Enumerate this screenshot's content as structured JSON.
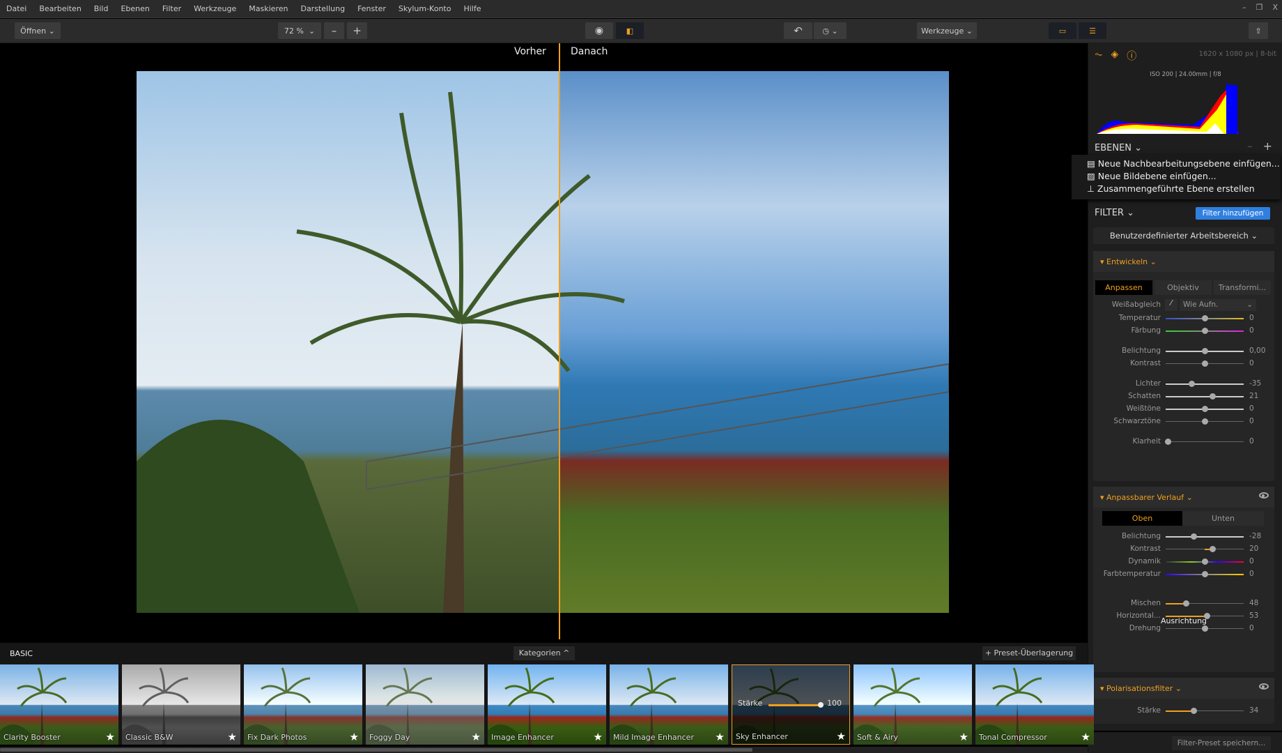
{
  "menu": [
    "Datei",
    "Bearbeiten",
    "Bild",
    "Ebenen",
    "Filter",
    "Werkzeuge",
    "Maskieren",
    "Darstellung",
    "Fenster",
    "Skylum-Konto",
    "Hilfe"
  ],
  "window_controls": {
    "minimize": "–",
    "restore": "❐",
    "close": "X"
  },
  "toolbar": {
    "open": "Öffnen",
    "zoom": "72 %",
    "zoom_out": "–",
    "zoom_in": "+",
    "tools": "Werkzeuge"
  },
  "canvas": {
    "before": "Vorher",
    "after": "Danach"
  },
  "info": {
    "dimensions": "1620 x 1080 px | 8-bit",
    "exif": "ISO 200 | 24.00mm | f/8"
  },
  "layers": {
    "title": "EBENEN",
    "menu": [
      "Neue Nachbearbeitungsebene einfügen...",
      "Neue Bildebene einfügen...",
      "Zusammengeführte Ebene erstellen"
    ]
  },
  "filter": {
    "title": "FILTER",
    "add": "Filter hinzufügen",
    "workspace": "Benutzerdefinierter Arbeitsbereich"
  },
  "develop": {
    "title": "Entwickeln",
    "tabs": [
      "Anpassen",
      "Objektiv",
      "Transformi..."
    ],
    "wb_label": "Weißabgleich",
    "wb_value": "Wie Aufn.",
    "sliders": [
      {
        "label": "Temperatur",
        "value": "0",
        "level": 0.5
      },
      {
        "label": "Färbung",
        "value": "0",
        "level": 0.5
      },
      {
        "label": "Belichtung",
        "value": "0,00",
        "level": 0.5
      },
      {
        "label": "Kontrast",
        "value": "0",
        "level": 0.5
      },
      {
        "label": "Lichter",
        "value": "-35",
        "level": 0.33
      },
      {
        "label": "Schatten",
        "value": "21",
        "level": 0.6
      },
      {
        "label": "Weißtöne",
        "value": "0",
        "level": 0.5
      },
      {
        "label": "Schwarztöne",
        "value": "0",
        "level": 0.5
      },
      {
        "label": "Klarheit",
        "value": "0",
        "level": 0.03
      }
    ]
  },
  "gradient": {
    "title": "Anpassbarer Verlauf",
    "tabs": [
      "Oben",
      "Unten"
    ],
    "align_title": "Ausrichtung",
    "sliders": [
      {
        "label": "Belichtung",
        "value": "-28",
        "level": 0.36
      },
      {
        "label": "Kontrast",
        "value": "20",
        "level": 0.6
      },
      {
        "label": "Dynamik",
        "value": "0",
        "level": 0.5
      },
      {
        "label": "Farbtemperatur",
        "value": "0",
        "level": 0.5
      },
      {
        "label": "Mischen",
        "value": "48",
        "level": 0.26
      },
      {
        "label": "Horizontal...",
        "value": "53",
        "level": 0.53
      },
      {
        "label": "Drehung",
        "value": "0",
        "level": 0.5
      }
    ]
  },
  "polarizer": {
    "title": "Polarisationsfilter",
    "sliders": [
      {
        "label": "Stärke",
        "value": "34",
        "level": 0.36
      }
    ]
  },
  "save_preset": "Filter-Preset speichern...",
  "presets": {
    "category": "BASIC",
    "categories_btn": "Kategorien ^",
    "overlay_btn": "+ Preset-Überlagerung",
    "strength_label": "Stärke",
    "strength_value": "100",
    "selected": "Sky Enhancer",
    "items": [
      "Clarity Booster",
      "Classic B&W",
      "Fix Dark Photos",
      "Foggy Day",
      "Image Enhancer",
      "Mild Image Enhancer",
      "Sky Enhancer",
      "Soft & Airy",
      "Tonal Compressor"
    ]
  },
  "colors": {
    "accent": "#f0a020",
    "button_blue": "#2f7fe0"
  }
}
